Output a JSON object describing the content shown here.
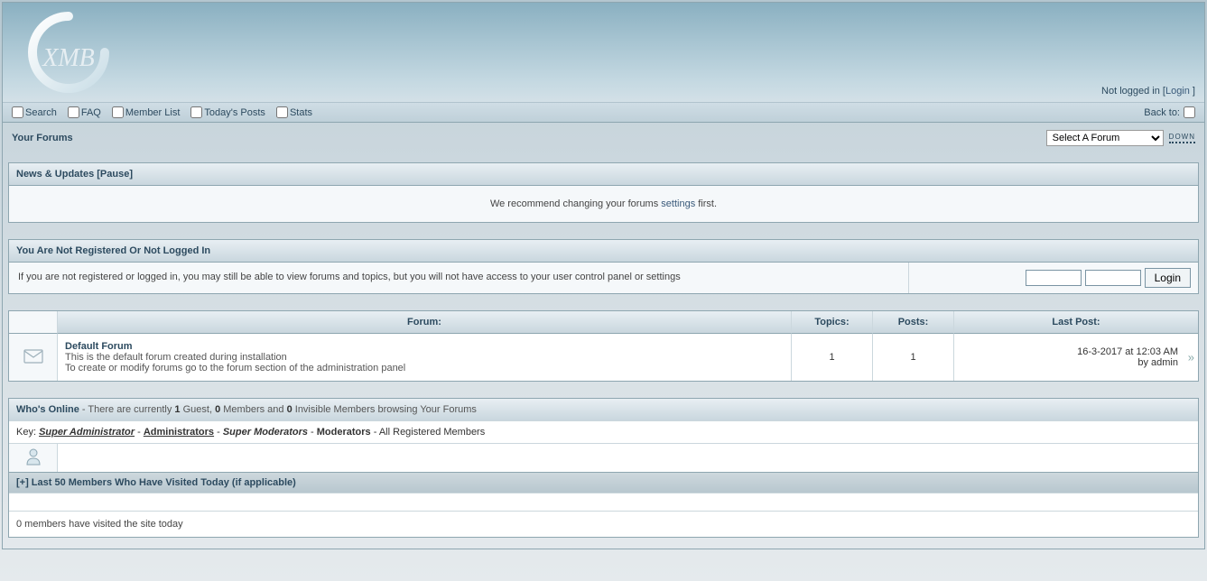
{
  "logo_text": "XMB",
  "login_status": {
    "prefix": "Not logged in [",
    "login_link": "Login",
    "suffix": " ]"
  },
  "toolbar": {
    "search": "Search",
    "faq": "FAQ",
    "memberlist": "Member List",
    "todays_posts": "Today's Posts",
    "stats": "Stats",
    "back_to": "Back to:"
  },
  "sub": {
    "title": "Your Forums",
    "select_label": "Select A Forum",
    "down": "down"
  },
  "news": {
    "title": "News & Updates",
    "pause": "[Pause]",
    "body_pre": "We recommend changing your forums ",
    "body_link": "settings",
    "body_post": " first."
  },
  "reg": {
    "title": "You Are Not Registered Or Not Logged In",
    "msg": "If you are not registered or logged in, you may still be able to view forums and topics, but you will not have access to your user control panel or settings",
    "login_btn": "Login"
  },
  "table": {
    "h_forum": "Forum:",
    "h_topics": "Topics:",
    "h_posts": "Posts:",
    "h_lastpost": "Last Post:",
    "rows": [
      {
        "name": "Default Forum",
        "desc1": "This is the default forum created during installation",
        "desc2": "To create or modify forums go to the forum section of the administration panel",
        "topics": "1",
        "posts": "1",
        "lastpost_date": "16-3-2017 at 12:03 AM",
        "lastpost_by": "by admin"
      }
    ]
  },
  "whos": {
    "title": "Who's Online",
    "sub_pre": " - There are currently ",
    "guests": "1",
    "sub_mid1": " Guest, ",
    "members": "0",
    "sub_mid2": " Members and ",
    "invisible": "0",
    "sub_post": " Invisible Members browsing Your Forums",
    "key_label": "Key: ",
    "sa": "Super Administrator",
    "admins": "Administrators",
    "sm": "Super Moderators",
    "mods": "Moderators",
    "all": "All Registered Members",
    "sep": " - "
  },
  "last50": {
    "title": "[+] Last 50 Members Who Have Visited Today (if applicable)",
    "msg": "0 members have visited the site today"
  }
}
